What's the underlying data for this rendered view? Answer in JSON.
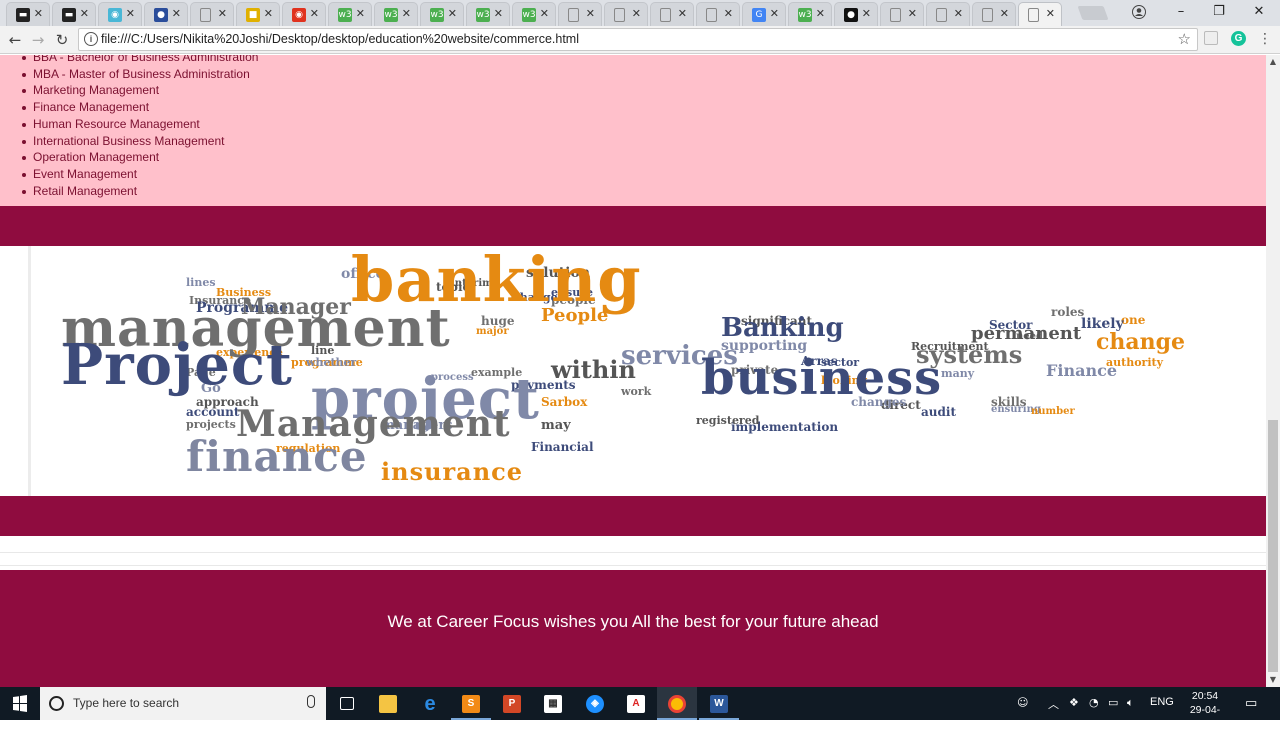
{
  "browser": {
    "tabs": [
      {
        "icon": "site-icon",
        "color": "#222222",
        "glyph": "▬"
      },
      {
        "icon": "site-icon",
        "color": "#222222",
        "glyph": "▬"
      },
      {
        "icon": "globe-icon",
        "color": "#49b7d6",
        "glyph": "◉"
      },
      {
        "icon": "profile-icon",
        "color": "#2a4d9b",
        "glyph": "●"
      },
      {
        "icon": "page-icon",
        "color": "#9a9a9a",
        "glyph": "▢"
      },
      {
        "icon": "site-icon",
        "color": "#e0b000",
        "glyph": "■"
      },
      {
        "icon": "record-icon",
        "color": "#e0321e",
        "glyph": "◉"
      },
      {
        "icon": "w3-icon",
        "color": "#4caf50",
        "glyph": "w3"
      },
      {
        "icon": "w3-icon",
        "color": "#4caf50",
        "glyph": "w3"
      },
      {
        "icon": "w3-icon",
        "color": "#4caf50",
        "glyph": "w3"
      },
      {
        "icon": "w3-icon",
        "color": "#4caf50",
        "glyph": "w3"
      },
      {
        "icon": "w3-icon",
        "color": "#4caf50",
        "glyph": "w3"
      },
      {
        "icon": "page-icon",
        "color": "#9a9a9a",
        "glyph": "▢"
      },
      {
        "icon": "page-icon",
        "color": "#9a9a9a",
        "glyph": "▢"
      },
      {
        "icon": "page-icon",
        "color": "#9a9a9a",
        "glyph": "▢"
      },
      {
        "icon": "page-icon",
        "color": "#9a9a9a",
        "glyph": "▢"
      },
      {
        "icon": "google-icon",
        "color": "#4285f4",
        "glyph": "G"
      },
      {
        "icon": "w3-icon",
        "color": "#4caf50",
        "glyph": "w3"
      },
      {
        "icon": "github-icon",
        "color": "#111111",
        "glyph": "●"
      },
      {
        "icon": "page-icon",
        "color": "#9a9a9a",
        "glyph": "▢"
      },
      {
        "icon": "page-icon",
        "color": "#9a9a9a",
        "glyph": "▢"
      },
      {
        "icon": "page-icon",
        "color": "#9a9a9a",
        "glyph": "▢"
      },
      {
        "icon": "page-icon",
        "color": "#9a9a9a",
        "glyph": "▢",
        "active": true
      }
    ],
    "url": "file:///C:/Users/Nikita%20Joshi/Desktop/desktop/education%20website/commerce.html"
  },
  "page": {
    "courses": [
      "BBA - Bachelor of Business Administration",
      "MBA - Master of Business Administration",
      "Marketing Management",
      "Finance Management",
      "Human Resource Management",
      "International Business Management",
      "Operation Management",
      "Event Management",
      "Retail Management"
    ],
    "wordcloud": {
      "big": [
        "banking",
        "management",
        "Project",
        "business",
        "project",
        "Management",
        "finance",
        "insurance"
      ],
      "medium": [
        "Banking",
        "Manager",
        "People",
        "services",
        "within",
        "Arras",
        "systems",
        "change",
        "Finance",
        "permanent",
        "likely",
        "roles",
        "one",
        "office",
        "solution",
        "Programme",
        "Insurance",
        "Business",
        "lines",
        "interim",
        "ensure",
        "huge",
        "major",
        "supporting",
        "Recruitment",
        "sector",
        "private",
        "looking",
        "many",
        "significant",
        "Sector",
        "need",
        "authority",
        "changes",
        "direct",
        "audit",
        "skills",
        "number",
        "ensuring",
        "registered",
        "implementation",
        "example",
        "experience",
        "whether",
        "approach",
        "account",
        "projects",
        "regulation",
        "managers",
        "may",
        "Financial",
        "Page",
        "programme",
        "process",
        "topic",
        "payments",
        "work",
        "Sarbox",
        "Go",
        "line",
        "Change",
        "people"
      ]
    },
    "footer_text": "We at Career Focus wishes you All the best for your future ahead"
  },
  "taskbar": {
    "search_placeholder": "Type here to search",
    "language": "ENG",
    "time": "20:54",
    "date": "29-04-2018"
  }
}
